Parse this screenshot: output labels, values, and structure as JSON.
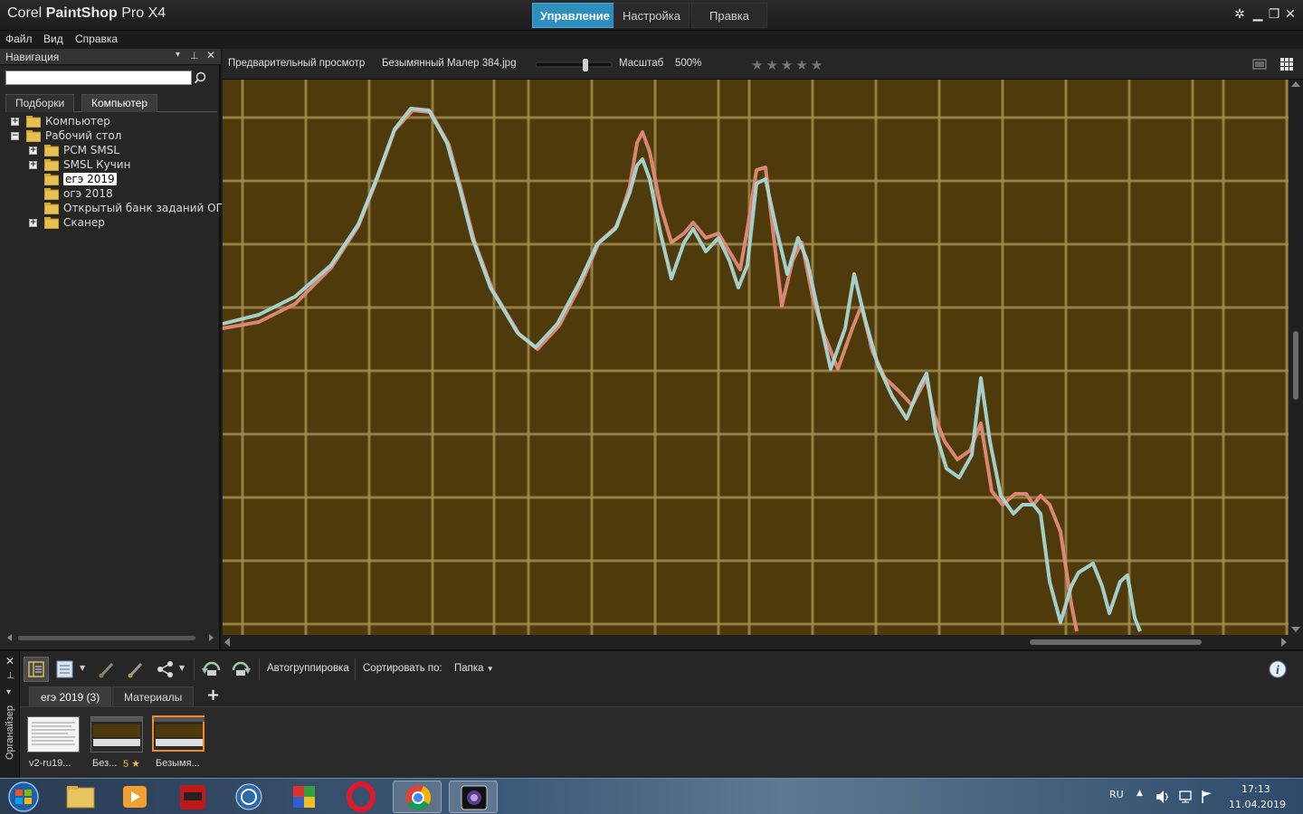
{
  "titlebar": {
    "app_name_prefix": "Corel",
    "app_name_bold": "PaintShop",
    "app_name_suffix": "Pro X4",
    "workspace_tabs": [
      "Управление",
      "Настройка",
      "Правка"
    ],
    "active_tab": "Управление"
  },
  "menu": [
    "Файл",
    "Вид",
    "Справка"
  ],
  "navigation": {
    "title": "Навигация",
    "search_value": "",
    "tabs": [
      "Подборки",
      "Компьютер"
    ],
    "active_tab": "Компьютер",
    "tree": [
      {
        "label": "Компьютер",
        "level": 0,
        "expander": "+"
      },
      {
        "label": "Рабочий стол",
        "level": 0,
        "expander": "−"
      },
      {
        "label": "PCM SMSL",
        "level": 1,
        "expander": "+"
      },
      {
        "label": "SMSL Кучин",
        "level": 1,
        "expander": "+"
      },
      {
        "label": "егэ 2019",
        "level": 1,
        "expander": "",
        "selected": true
      },
      {
        "label": "огэ 2018",
        "level": 1,
        "expander": ""
      },
      {
        "label": "Открытый банк заданий ОГЭ_",
        "level": 1,
        "expander": ""
      },
      {
        "label": "Сканер",
        "level": 1,
        "expander": "+"
      }
    ]
  },
  "preview_bar": {
    "preview_label": "Предварительный просмотр",
    "filename": "Безымянный Малер 384.jpg",
    "zoom_label": "Масштаб",
    "zoom_value": "500%",
    "rating": 0,
    "rating_max": 5
  },
  "image_preview": {
    "description_colors": {
      "background": "#4f3a0b",
      "grid": "#a08a4e",
      "trace_blue": "#a9d6d4",
      "trace_red": "#e08a7a"
    }
  },
  "organizer": {
    "side_label": "Органайзер",
    "autogroup_label": "Автогруппировка",
    "sort_label": "Сортировать по:",
    "sort_value": "Папка",
    "tabs": [
      "егэ 2019 (3)",
      "Материалы"
    ],
    "active_tab": "егэ 2019 (3)",
    "add_tab": "+",
    "thumbnails": [
      {
        "caption": "v2-ru19...",
        "rating": ""
      },
      {
        "caption": "Без...",
        "rating": "5 ★"
      },
      {
        "caption": "Безымя...",
        "rating": "",
        "selected": true
      }
    ]
  },
  "taskbar": {
    "language": "RU",
    "time": "17:13",
    "date": "11.04.2019"
  }
}
